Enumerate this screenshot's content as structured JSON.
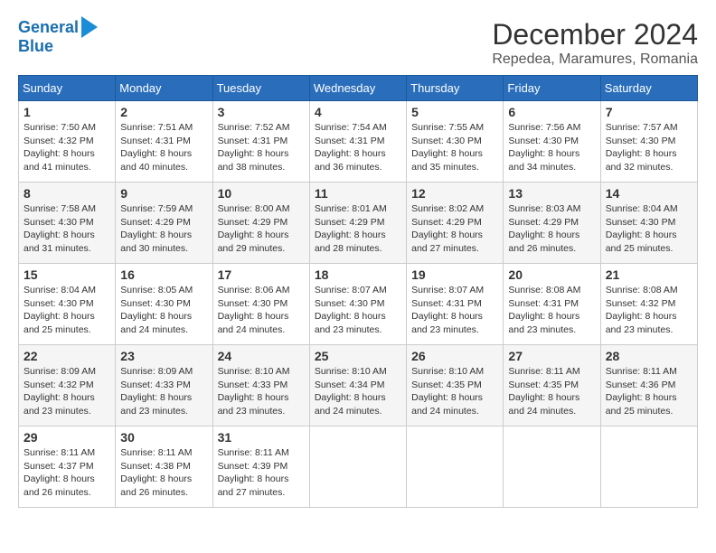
{
  "logo": {
    "line1": "General",
    "line2": "Blue"
  },
  "title": "December 2024",
  "subtitle": "Repedea, Maramures, Romania",
  "weekdays": [
    "Sunday",
    "Monday",
    "Tuesday",
    "Wednesday",
    "Thursday",
    "Friday",
    "Saturday"
  ],
  "weeks": [
    [
      {
        "day": "1",
        "sunrise": "7:50 AM",
        "sunset": "4:32 PM",
        "daylight": "8 hours and 41 minutes."
      },
      {
        "day": "2",
        "sunrise": "7:51 AM",
        "sunset": "4:31 PM",
        "daylight": "8 hours and 40 minutes."
      },
      {
        "day": "3",
        "sunrise": "7:52 AM",
        "sunset": "4:31 PM",
        "daylight": "8 hours and 38 minutes."
      },
      {
        "day": "4",
        "sunrise": "7:54 AM",
        "sunset": "4:31 PM",
        "daylight": "8 hours and 36 minutes."
      },
      {
        "day": "5",
        "sunrise": "7:55 AM",
        "sunset": "4:30 PM",
        "daylight": "8 hours and 35 minutes."
      },
      {
        "day": "6",
        "sunrise": "7:56 AM",
        "sunset": "4:30 PM",
        "daylight": "8 hours and 34 minutes."
      },
      {
        "day": "7",
        "sunrise": "7:57 AM",
        "sunset": "4:30 PM",
        "daylight": "8 hours and 32 minutes."
      }
    ],
    [
      {
        "day": "8",
        "sunrise": "7:58 AM",
        "sunset": "4:30 PM",
        "daylight": "8 hours and 31 minutes."
      },
      {
        "day": "9",
        "sunrise": "7:59 AM",
        "sunset": "4:29 PM",
        "daylight": "8 hours and 30 minutes."
      },
      {
        "day": "10",
        "sunrise": "8:00 AM",
        "sunset": "4:29 PM",
        "daylight": "8 hours and 29 minutes."
      },
      {
        "day": "11",
        "sunrise": "8:01 AM",
        "sunset": "4:29 PM",
        "daylight": "8 hours and 28 minutes."
      },
      {
        "day": "12",
        "sunrise": "8:02 AM",
        "sunset": "4:29 PM",
        "daylight": "8 hours and 27 minutes."
      },
      {
        "day": "13",
        "sunrise": "8:03 AM",
        "sunset": "4:29 PM",
        "daylight": "8 hours and 26 minutes."
      },
      {
        "day": "14",
        "sunrise": "8:04 AM",
        "sunset": "4:30 PM",
        "daylight": "8 hours and 25 minutes."
      }
    ],
    [
      {
        "day": "15",
        "sunrise": "8:04 AM",
        "sunset": "4:30 PM",
        "daylight": "8 hours and 25 minutes."
      },
      {
        "day": "16",
        "sunrise": "8:05 AM",
        "sunset": "4:30 PM",
        "daylight": "8 hours and 24 minutes."
      },
      {
        "day": "17",
        "sunrise": "8:06 AM",
        "sunset": "4:30 PM",
        "daylight": "8 hours and 24 minutes."
      },
      {
        "day": "18",
        "sunrise": "8:07 AM",
        "sunset": "4:30 PM",
        "daylight": "8 hours and 23 minutes."
      },
      {
        "day": "19",
        "sunrise": "8:07 AM",
        "sunset": "4:31 PM",
        "daylight": "8 hours and 23 minutes."
      },
      {
        "day": "20",
        "sunrise": "8:08 AM",
        "sunset": "4:31 PM",
        "daylight": "8 hours and 23 minutes."
      },
      {
        "day": "21",
        "sunrise": "8:08 AM",
        "sunset": "4:32 PM",
        "daylight": "8 hours and 23 minutes."
      }
    ],
    [
      {
        "day": "22",
        "sunrise": "8:09 AM",
        "sunset": "4:32 PM",
        "daylight": "8 hours and 23 minutes."
      },
      {
        "day": "23",
        "sunrise": "8:09 AM",
        "sunset": "4:33 PM",
        "daylight": "8 hours and 23 minutes."
      },
      {
        "day": "24",
        "sunrise": "8:10 AM",
        "sunset": "4:33 PM",
        "daylight": "8 hours and 23 minutes."
      },
      {
        "day": "25",
        "sunrise": "8:10 AM",
        "sunset": "4:34 PM",
        "daylight": "8 hours and 24 minutes."
      },
      {
        "day": "26",
        "sunrise": "8:10 AM",
        "sunset": "4:35 PM",
        "daylight": "8 hours and 24 minutes."
      },
      {
        "day": "27",
        "sunrise": "8:11 AM",
        "sunset": "4:35 PM",
        "daylight": "8 hours and 24 minutes."
      },
      {
        "day": "28",
        "sunrise": "8:11 AM",
        "sunset": "4:36 PM",
        "daylight": "8 hours and 25 minutes."
      }
    ],
    [
      {
        "day": "29",
        "sunrise": "8:11 AM",
        "sunset": "4:37 PM",
        "daylight": "8 hours and 26 minutes."
      },
      {
        "day": "30",
        "sunrise": "8:11 AM",
        "sunset": "4:38 PM",
        "daylight": "8 hours and 26 minutes."
      },
      {
        "day": "31",
        "sunrise": "8:11 AM",
        "sunset": "4:39 PM",
        "daylight": "8 hours and 27 minutes."
      },
      null,
      null,
      null,
      null
    ]
  ],
  "labels": {
    "sunrise": "Sunrise:",
    "sunset": "Sunset:",
    "daylight": "Daylight:"
  }
}
